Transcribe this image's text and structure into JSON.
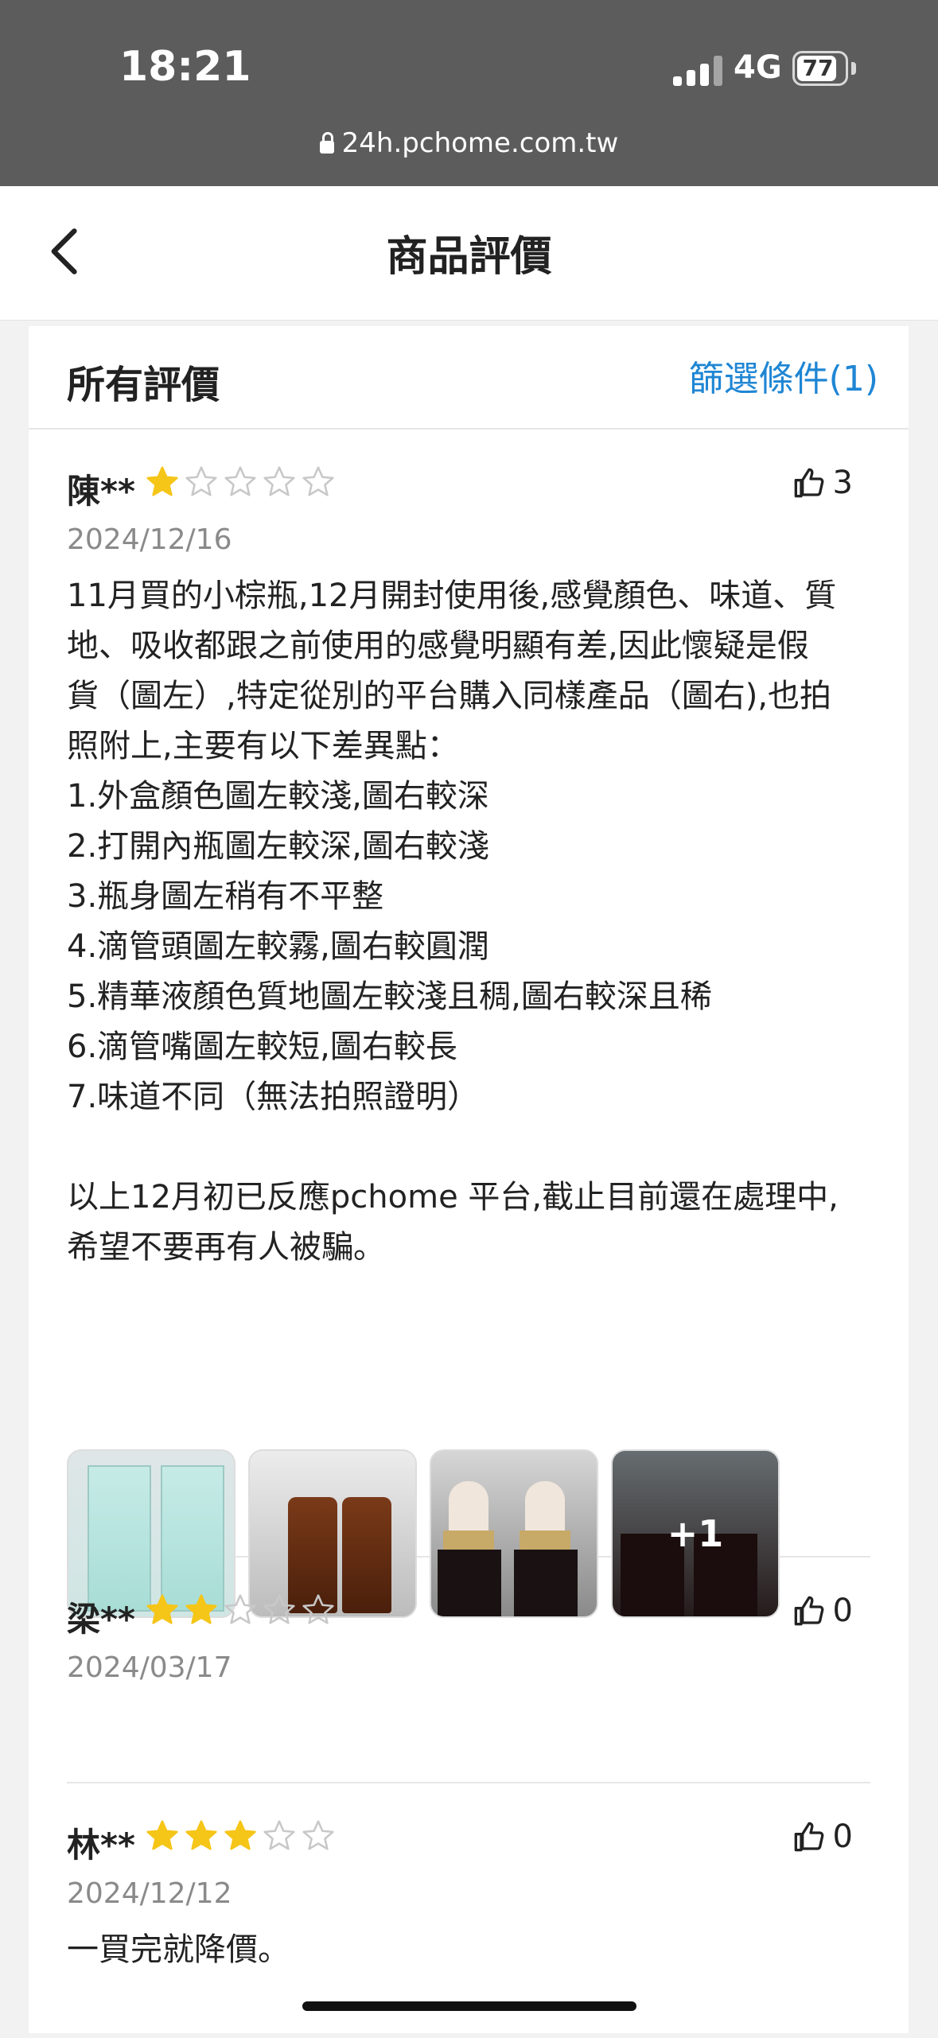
{
  "status_bar": {
    "time": "18:21",
    "network": "4G",
    "battery": "77"
  },
  "url_bar": {
    "domain": "24h.pchome.com.tw"
  },
  "header": {
    "title": "商品評價"
  },
  "reviews_section": {
    "label": "所有評價",
    "filter": "篩選條件(1)"
  },
  "reviews": [
    {
      "name": "陳**",
      "rating": 1,
      "likes": "3",
      "date": "2024/12/16",
      "body": "11月買的小棕瓶,12月開封使用後,感覺顏色、味道、質\n地、吸收都跟之前使用的感覺明顯有差,因此懷疑是假\n貨（圖左）,特定從別的平台購入同樣產品（圖右),也拍\n照附上,主要有以下差異點：\n1.外盒顏色圖左較淺,圖右較深\n2.打開內瓶圖左較深,圖右較淺\n3.瓶身圖左稍有不平整\n4.滴管頭圖左較霧,圖右較圓潤\n5.精華液顏色質地圖左較淺且稠,圖右較深且稀\n6.滴管嘴圖左較短,圖右較長\n7.味道不同（無法拍照證明）\n\n以上12月初已反應pchome 平台,截止目前還在處理中,\n希望不要再有人被騙。",
      "more_photos": "+1"
    },
    {
      "name": "梁**",
      "rating": 2,
      "likes": "0",
      "date": "2024/03/17",
      "body": ""
    },
    {
      "name": "林**",
      "rating": 3,
      "likes": "0",
      "date": "2024/12/12",
      "body": "一買完就降價。"
    }
  ],
  "colors": {
    "star_filled": "#f5c518",
    "star_empty": "#c8c8c8",
    "link": "#1f86d4"
  }
}
